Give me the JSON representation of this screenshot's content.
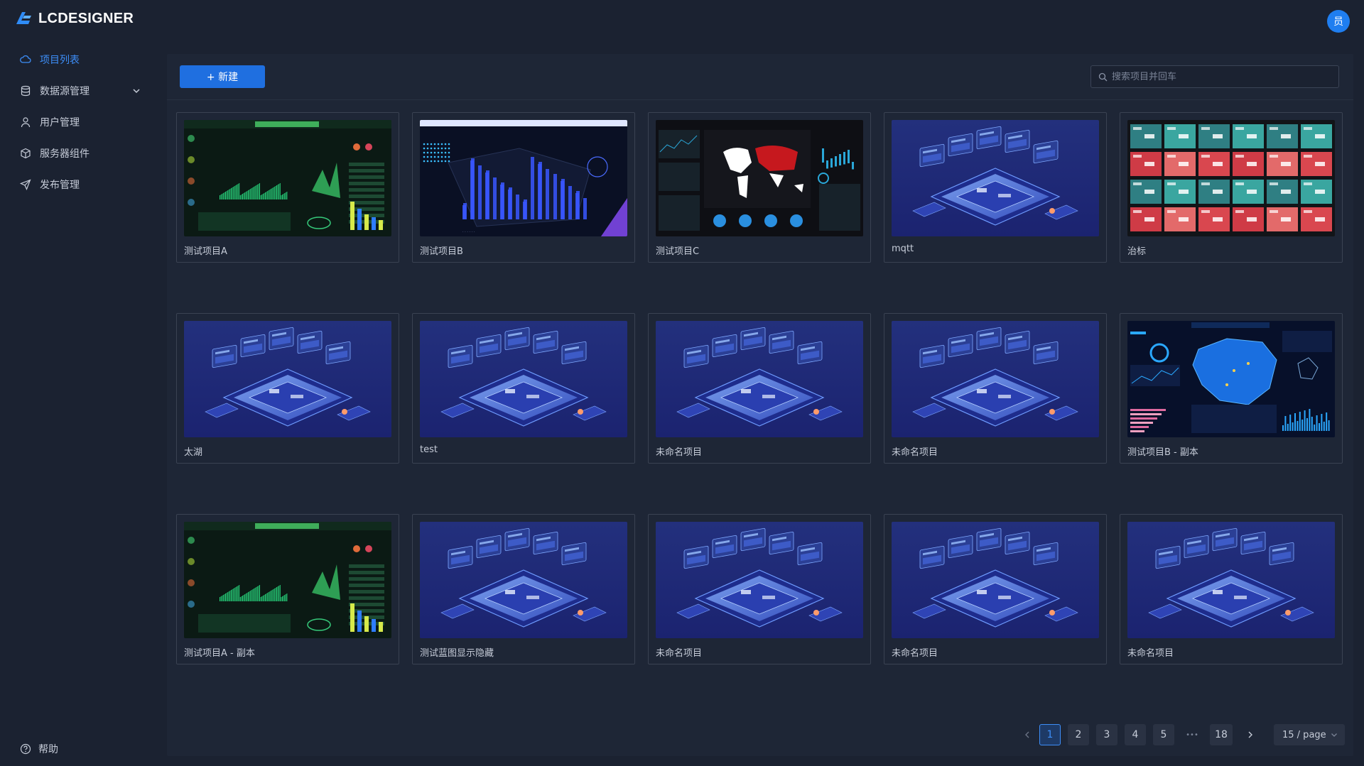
{
  "app": {
    "logo_text": "LCDESIGNER",
    "avatar_text": "员"
  },
  "sidebar": {
    "items": [
      {
        "label": "项目列表",
        "icon": "cloud-icon",
        "active": true
      },
      {
        "label": "数据源管理",
        "icon": "database-icon",
        "active": false
      },
      {
        "label": "用户管理",
        "icon": "user-icon",
        "active": false
      },
      {
        "label": "服务器组件",
        "icon": "cube-icon",
        "active": false
      },
      {
        "label": "发布管理",
        "icon": "send-icon",
        "active": false
      }
    ],
    "help_label": "帮助"
  },
  "toolbar": {
    "new_label": "+ 新建",
    "search_placeholder": "搜索项目并回车"
  },
  "projects": [
    {
      "name": "测试项目A",
      "thumb": "green-dashboard"
    },
    {
      "name": "测试项目B",
      "thumb": "blue-bars-map"
    },
    {
      "name": "测试项目C",
      "thumb": "world-map-dashboard"
    },
    {
      "name": "mqtt",
      "thumb": "isometric-default"
    },
    {
      "name": "治标",
      "thumb": "tile-grid"
    },
    {
      "name": "太湖",
      "thumb": "isometric-default"
    },
    {
      "name": "test",
      "thumb": "isometric-default"
    },
    {
      "name": "未命名项目",
      "thumb": "isometric-default"
    },
    {
      "name": "未命名项目",
      "thumb": "isometric-default"
    },
    {
      "name": "测试项目B - 副本",
      "thumb": "china-map-dashboard"
    },
    {
      "name": "测试项目A - 副本",
      "thumb": "green-dashboard"
    },
    {
      "name": "测试蓝图显示隐藏",
      "thumb": "isometric-default"
    },
    {
      "name": "未命名项目",
      "thumb": "isometric-default"
    },
    {
      "name": "未命名项目",
      "thumb": "isometric-default"
    },
    {
      "name": "未命名项目",
      "thumb": "isometric-default"
    }
  ],
  "pagination": {
    "pages": [
      "1",
      "2",
      "3",
      "4",
      "5"
    ],
    "ellipsis": "•••",
    "last": "18",
    "current": "1",
    "page_size": "15 / page"
  }
}
